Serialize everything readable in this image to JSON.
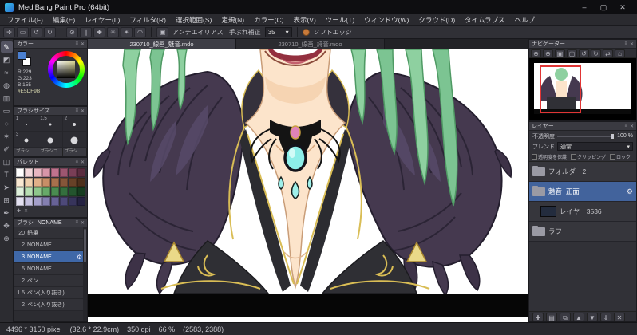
{
  "window": {
    "title": "MediBang Paint Pro (64bit)",
    "minimize": "–",
    "maximize": "▢",
    "close": "✕"
  },
  "panel_chrome": {
    "menu_glyph": "≡",
    "close_glyph": "✕",
    "dropdown_glyph": "▾"
  },
  "menu": {
    "items": [
      "ファイル(F)",
      "編集(E)",
      "レイヤー(L)",
      "フィルタ(R)",
      "選択範囲(S)",
      "定規(N)",
      "カラー(C)",
      "表示(V)",
      "ツール(T)",
      "ウィンドウ(W)",
      "クラウド(D)",
      "タイムラプス",
      "ヘルプ"
    ]
  },
  "toolbar": {
    "icons_left": [
      {
        "name": "transform-icon",
        "glyph": "✛"
      },
      {
        "name": "select-rect-icon",
        "glyph": "▭"
      },
      {
        "name": "undo-icon",
        "glyph": "↺"
      },
      {
        "name": "redo-icon",
        "glyph": "↻"
      }
    ],
    "icons_snap": [
      {
        "name": "snap-off-icon",
        "glyph": "⊘"
      },
      {
        "name": "snap-parallel-icon",
        "glyph": "∥"
      },
      {
        "name": "snap-cross-icon",
        "glyph": "✚"
      },
      {
        "name": "snap-vanishing-icon",
        "glyph": "✳"
      },
      {
        "name": "snap-radial-icon",
        "glyph": "✴"
      },
      {
        "name": "snap-ellipse-icon",
        "glyph": "◠"
      }
    ],
    "antialias_glyph": "▣",
    "antialias_label": "アンチエイリアス",
    "stabilizer_label": "手ぶれ補正",
    "stabilizer_value": "35",
    "soft_edge_label": "ソフトエッジ"
  },
  "tool_strip": {
    "tools": [
      {
        "name": "brush-tool",
        "glyph": "✎",
        "selected": true
      },
      {
        "name": "eraser-tool",
        "glyph": "◩",
        "selected": false
      },
      {
        "name": "smudge-tool",
        "glyph": "≈",
        "selected": false
      },
      {
        "name": "bucket-tool",
        "glyph": "◍",
        "selected": false
      },
      {
        "name": "gradient-tool",
        "glyph": "▥",
        "selected": false
      },
      {
        "name": "select-tool",
        "glyph": "▭",
        "selected": false
      },
      {
        "name": "lasso-tool",
        "glyph": "◌",
        "selected": false
      },
      {
        "name": "magic-wand-tool",
        "glyph": "✶",
        "selected": false
      },
      {
        "name": "select-pen-tool",
        "glyph": "✐",
        "selected": false
      },
      {
        "name": "select-eraser-tool",
        "glyph": "◫",
        "selected": false
      },
      {
        "name": "text-tool",
        "glyph": "T",
        "selected": false
      },
      {
        "name": "operation-tool",
        "glyph": "➤",
        "selected": false
      },
      {
        "name": "divide-tool",
        "glyph": "⊞",
        "selected": false
      },
      {
        "name": "eyedropper-tool",
        "glyph": "✒",
        "selected": false
      },
      {
        "name": "hand-tool",
        "glyph": "✥",
        "selected": false
      },
      {
        "name": "zoom-tool",
        "glyph": "⊕",
        "selected": false
      }
    ]
  },
  "color_panel": {
    "title": "カラー",
    "r": "R:229",
    "g": "G:223",
    "b": "B:155",
    "hex": "#E5DF9B",
    "primary_swatch": "#4a7fd0",
    "secondary_swatch": "#ffffff"
  },
  "brush_size_panel": {
    "title": "ブラシサイズ",
    "cells": [
      {
        "label": "1",
        "dot": 2
      },
      {
        "label": "1.5",
        "dot": 3
      },
      {
        "label": "2",
        "dot": 4
      },
      {
        "label": "3",
        "dot": 5
      },
      {
        "label": "",
        "dot": 7
      },
      {
        "label": "",
        "dot": 9
      }
    ],
    "tabs": [
      "ブラシ...",
      "ブラシコ...",
      "ブラシ..."
    ]
  },
  "palette_panel": {
    "title": "パレット",
    "colors": [
      "#ffffff",
      "#f2d7da",
      "#e7b6c1",
      "#d795a9",
      "#bf738e",
      "#9c5670",
      "#793e56",
      "#5a2c3f",
      "#f9e8d2",
      "#efd0ae",
      "#e1b089",
      "#c88e67",
      "#a8704d",
      "#855639",
      "#674127",
      "#4d2f1b",
      "#def0db",
      "#b8deb3",
      "#8ec68b",
      "#67a969",
      "#4a8b51",
      "#346f3e",
      "#23542e",
      "#163c20",
      "#e3e0f0",
      "#c4c0df",
      "#a49fca",
      "#847fb1",
      "#676296",
      "#4d4979",
      "#37345b",
      "#252242"
    ],
    "footer_icons": [
      {
        "name": "add-color-icon",
        "glyph": "✚"
      },
      {
        "name": "delete-color-icon",
        "glyph": "✕"
      }
    ]
  },
  "brush_panel": {
    "title": "ブラシ",
    "current": "NONAME",
    "brushes": [
      {
        "size": "20",
        "name": "鉛筆",
        "selected": false
      },
      {
        "size": "2",
        "name": "NONAME",
        "selected": false
      },
      {
        "size": "3",
        "name": "NONAME",
        "selected": true
      },
      {
        "size": "5",
        "name": "NONAME",
        "selected": false
      },
      {
        "size": "2",
        "name": "ペン",
        "selected": false
      },
      {
        "size": "1.5",
        "name": "ペン(入り抜き)",
        "selected": false
      },
      {
        "size": "2",
        "name": "ペン(入り抜き)",
        "selected": false
      }
    ]
  },
  "canvas": {
    "tabs": [
      {
        "label": "230710_線画_魅音.mdo",
        "active": true
      },
      {
        "label": "230710_線画_詩音.mdo",
        "active": false
      }
    ]
  },
  "navigator": {
    "title": "ナビゲーター",
    "icons": [
      {
        "name": "zoom-out-icon",
        "glyph": "⊖"
      },
      {
        "name": "zoom-in-icon",
        "glyph": "⊕"
      },
      {
        "name": "zoom-100-icon",
        "glyph": "▣"
      },
      {
        "name": "fit-window-icon",
        "glyph": "▢"
      },
      {
        "name": "rotate-left-icon",
        "glyph": "↺"
      },
      {
        "name": "rotate-right-icon",
        "glyph": "↻"
      },
      {
        "name": "flip-horizontal-icon",
        "glyph": "⇄"
      },
      {
        "name": "reset-view-icon",
        "glyph": "⌂"
      }
    ]
  },
  "layer_panel": {
    "title": "レイヤー",
    "opacity_label": "不透明度",
    "opacity_value": "100 %",
    "blend_label": "ブレンド",
    "blend_value": "通常",
    "checks": [
      {
        "name": "protect-alpha-checkbox",
        "label": "透明度を保護"
      },
      {
        "name": "clipping-checkbox",
        "label": "クリッピング"
      },
      {
        "name": "lock-checkbox",
        "label": "ロック"
      }
    ],
    "layers": [
      {
        "name": "フォルダー2",
        "type": "folder",
        "selected": false,
        "indent": 0
      },
      {
        "name": "魅音_正面",
        "type": "folder",
        "selected": true,
        "indent": 0
      },
      {
        "name": "レイヤー3536",
        "type": "layer",
        "selected": false,
        "indent": 1
      },
      {
        "name": "ラフ",
        "type": "folder",
        "selected": false,
        "indent": 0
      }
    ],
    "footer_icons": [
      {
        "name": "add-layer-icon",
        "glyph": "✚"
      },
      {
        "name": "add-folder-icon",
        "glyph": "▤"
      },
      {
        "name": "duplicate-layer-icon",
        "glyph": "⧉"
      },
      {
        "name": "move-up-icon",
        "glyph": "▲"
      },
      {
        "name": "move-down-icon",
        "glyph": "▼"
      },
      {
        "name": "merge-down-icon",
        "glyph": "⇓"
      },
      {
        "name": "delete-layer-icon",
        "glyph": "✕"
      }
    ]
  },
  "status_bar": {
    "dimensions": "4496 * 3150 pixel",
    "physical": "(32.6 * 22.9cm)",
    "dpi": "350 dpi",
    "zoom": "66 %",
    "cursor": "(2583, 2388)"
  },
  "artwork_colors": {
    "hair": "#8ed0a0",
    "skin": "#fce4cb",
    "feathers": "#45394f",
    "gem_teal": "#8deee8",
    "gem_pink": "#e083b8",
    "gold": "#d9bd55",
    "jacket": "#303036",
    "background": "#ffffff"
  }
}
